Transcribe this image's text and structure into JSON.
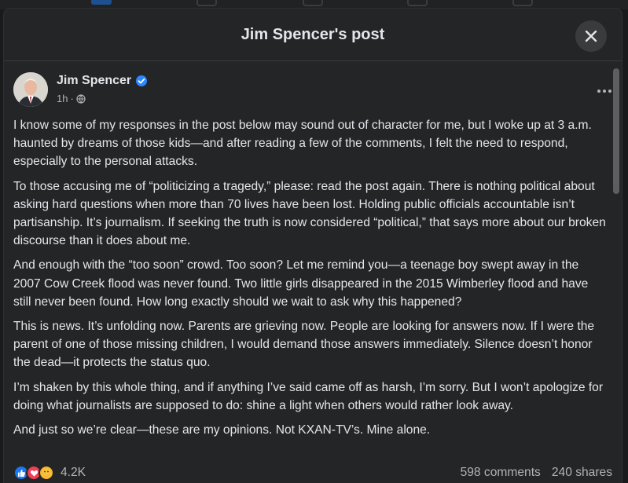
{
  "dialog": {
    "title": "Jim Spencer's post",
    "close_icon": "close-icon"
  },
  "post": {
    "author": "Jim Spencer",
    "verified_icon": "verified-badge-icon",
    "time": "1h",
    "separator": "·",
    "audience_icon": "globe-icon",
    "more_icon": "more-options-icon",
    "paragraphs": [
      "I know some of my responses in the post below may sound out of character for me, but I woke up at 3 a.m. haunted by dreams of those kids—and after reading a few of the comments, I felt the need to respond, especially to the personal attacks.",
      "To those accusing me of “politicizing a tragedy,” please: read the post again. There is nothing political about asking hard questions when more than 70 lives have been lost. Holding public officials accountable isn’t partisanship. It’s journalism. If seeking the truth is now considered “political,” that says more about our broken discourse than it does about me.",
      "And enough with the “too soon” crowd. Too soon? Let me remind you—a teenage boy swept away in the 2007 Cow Creek flood was never found. Two little girls disappeared in the 2015 Wimberley flood and have still never been found. How long exactly should we wait to ask why this happened?",
      "This is news. It’s unfolding now. Parents are grieving now. People are looking for answers now. If I were the parent of one of those missing children, I would demand those answers immediately. Silence doesn’t honor the dead—it protects the status quo.",
      "I’m shaken by this whole thing, and if anything I’ve said came off as harsh, I’m sorry. But I won’t apologize for doing what journalists are supposed to do: shine a light when others would rather look away.",
      "And just so we’re clear—these are my opinions. Not KXAN-TV’s. Mine alone."
    ]
  },
  "engagement": {
    "reaction_icons": [
      "like-reaction-icon",
      "love-reaction-icon",
      "care-reaction-icon"
    ],
    "reaction_count": "4.2K",
    "comments": "598 comments",
    "shares": "240 shares"
  },
  "colors": {
    "background": "#242526",
    "text": "#e4e6eb",
    "secondary_text": "#b0b3b8",
    "verified": "#2d88ff",
    "like": "#1877f2",
    "love": "#f33e58"
  }
}
